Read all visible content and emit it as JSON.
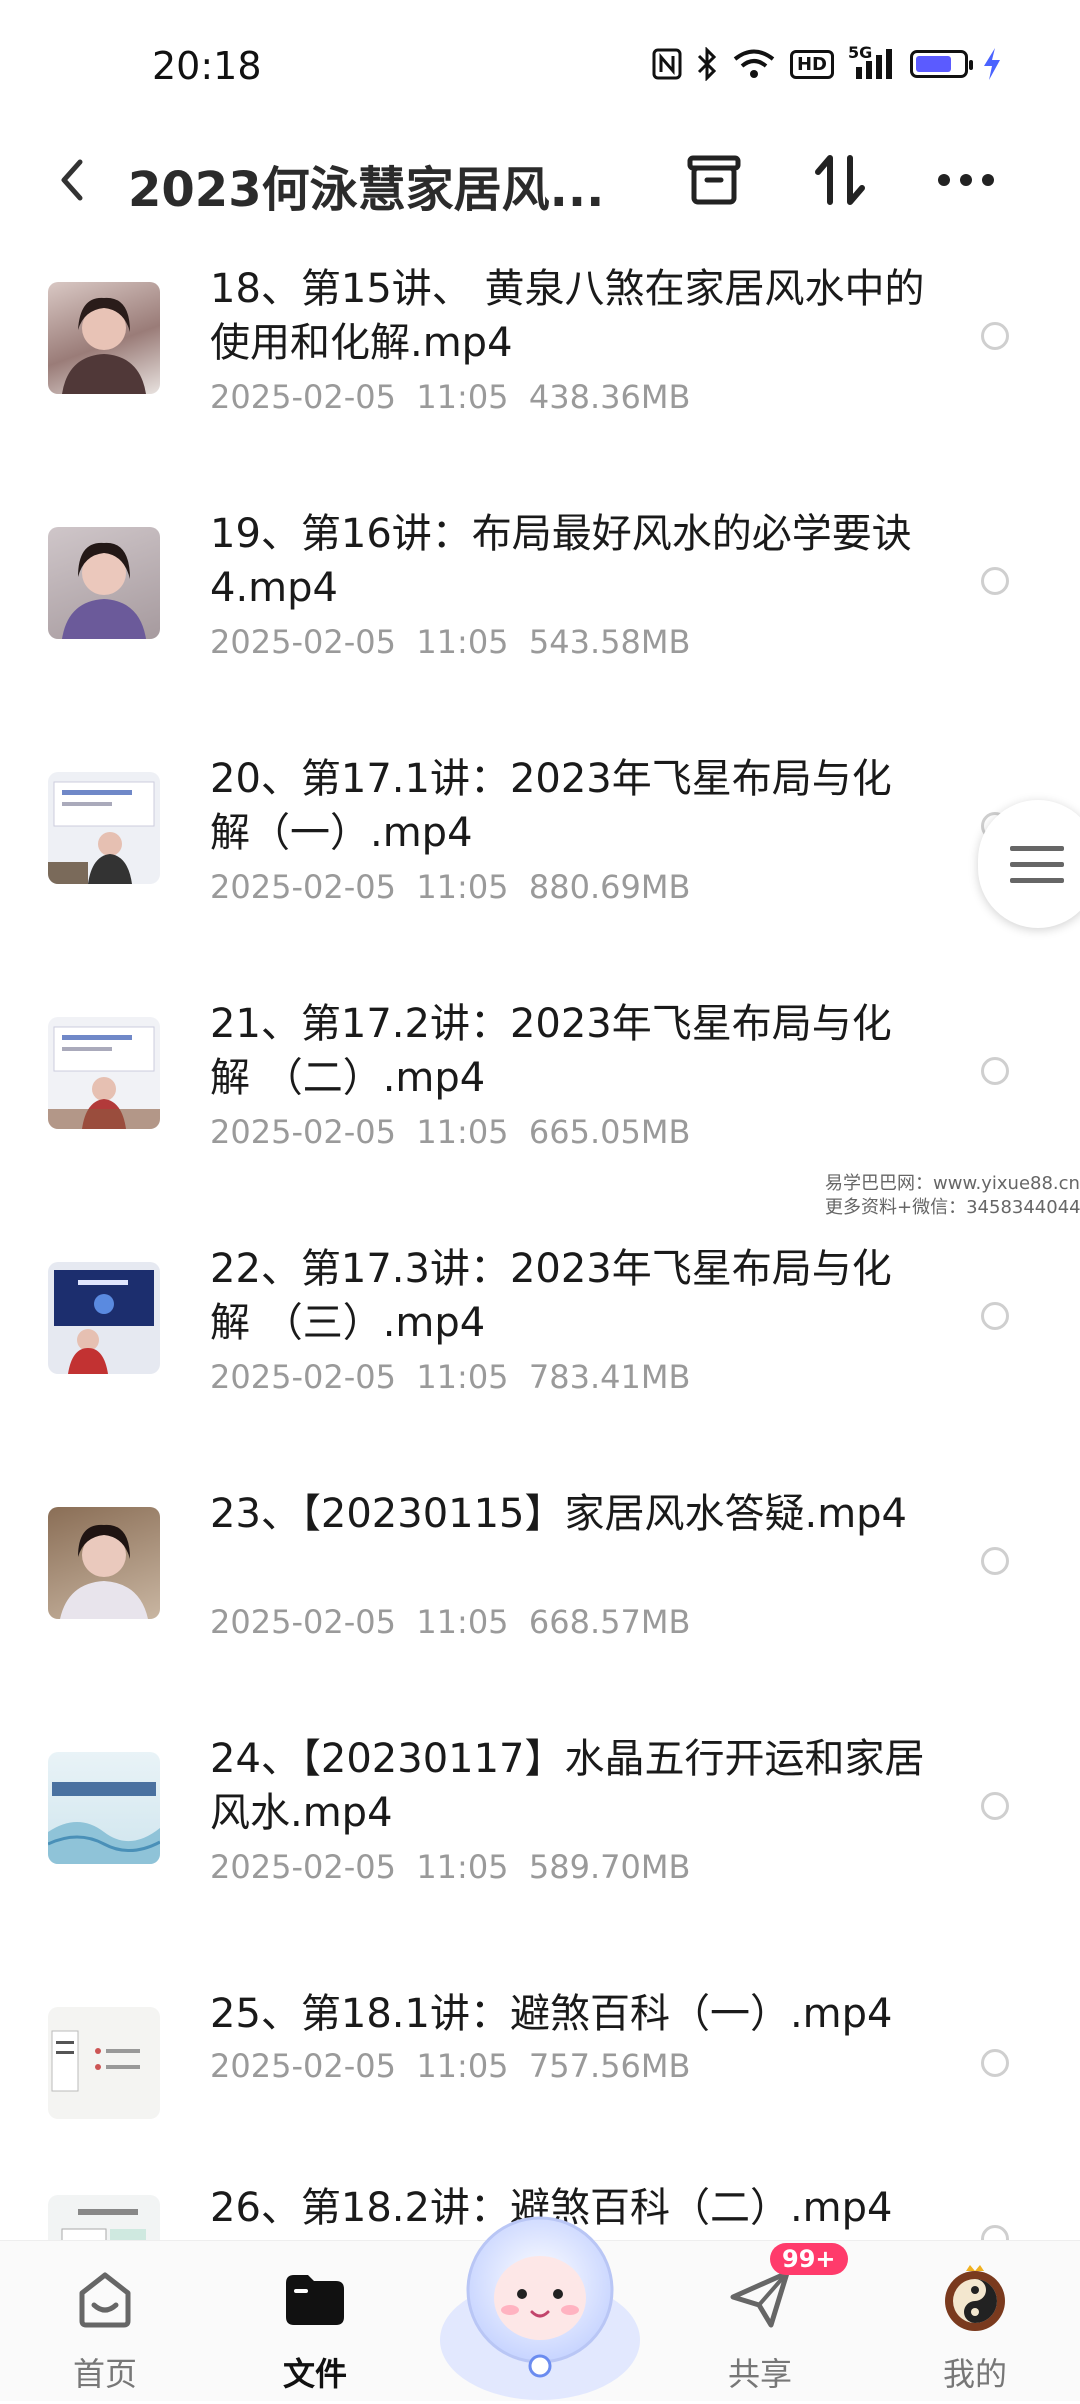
{
  "status_bar": {
    "time": "20:18",
    "icons": [
      "nfc-icon",
      "bluetooth-icon",
      "wifi-icon",
      "hd-icon",
      "signal-5g-icon",
      "battery-icon",
      "charging-icon"
    ],
    "hd_label": "HD",
    "network_label": "5G",
    "battery_level": 0.75
  },
  "header": {
    "title": "2023何泳慧家居风...",
    "back_icon": "back-arrow-icon",
    "actions": [
      "archive-icon",
      "sort-icon",
      "more-icon"
    ]
  },
  "files": [
    {
      "name": "18、第15讲、 黄泉八煞在家居风水中的使用和化解.mp4",
      "date": "2025-02-05  11:05",
      "size": "438.36MB"
    },
    {
      "name": "19、第16讲：布局最好风水的必学要诀4.mp4",
      "date": "2025-02-05  11:05",
      "size": "543.58MB"
    },
    {
      "name": "20、第17.1讲：2023年飞星布局与化解（一）.mp4",
      "date": "2025-02-05  11:05",
      "size": "880.69MB"
    },
    {
      "name": "21、第17.2讲：2023年飞星布局与化解 （二）.mp4",
      "date": "2025-02-05  11:05",
      "size": "665.05MB"
    },
    {
      "name": "22、第17.3讲：2023年飞星布局与化解 （三）.mp4",
      "date": "2025-02-05  11:05",
      "size": "783.41MB"
    },
    {
      "name": "23、【20230115】家居风水答疑.mp4",
      "date": "2025-02-05  11:05",
      "size": "668.57MB"
    },
    {
      "name": "24、【20230117】水晶五行开运和家居风水.mp4",
      "date": "2025-02-05  11:05",
      "size": "589.70MB"
    },
    {
      "name": "25、第18.1讲：避煞百科（一）.mp4",
      "date": "2025-02-05  11:05",
      "size": "757.56MB"
    },
    {
      "name": "26、第18.2讲：避煞百科（二）.mp4",
      "date": "",
      "size": ""
    }
  ],
  "watermark": {
    "line1": "易学巴巴网：www.yixue88.cn",
    "line2": "更多资料+微信：3458344044"
  },
  "tabbar": {
    "tabs": [
      {
        "label": "首页",
        "icon": "home-icon",
        "active": false
      },
      {
        "label": "文件",
        "icon": "folder-icon",
        "active": true
      },
      {
        "label": "",
        "icon": "mascot-icon",
        "active": false
      },
      {
        "label": "共享",
        "icon": "share-plane-icon",
        "active": false,
        "badge": "99+"
      },
      {
        "label": "我的",
        "icon": "avatar-icon",
        "active": false
      }
    ]
  },
  "colors": {
    "accent": "#4a63ff",
    "badge": "#ff3b6b",
    "meta_text": "#9a9a9a"
  }
}
